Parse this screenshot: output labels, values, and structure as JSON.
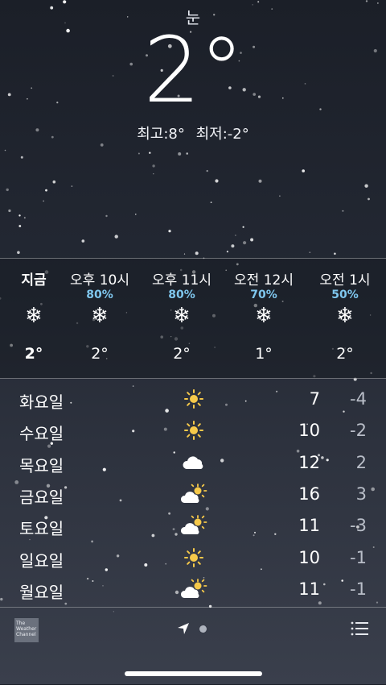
{
  "current": {
    "condition": "눈",
    "temperature": "2°",
    "high": "최고:8°",
    "low": "최저:-2°"
  },
  "hourly": [
    {
      "label": "지금",
      "pop": "",
      "icon": "snowflake-icon",
      "temp": "2°"
    },
    {
      "label": "오후 10시",
      "pop": "80%",
      "icon": "snowflake-icon",
      "temp": "2°"
    },
    {
      "label": "오후 11시",
      "pop": "80%",
      "icon": "snowflake-icon",
      "temp": "2°"
    },
    {
      "label": "오전 12시",
      "pop": "70%",
      "icon": "snowflake-icon",
      "temp": "1°"
    },
    {
      "label": "오전 1시",
      "pop": "50%",
      "icon": "snowflake-icon",
      "temp": "2°"
    }
  ],
  "daily": [
    {
      "day": "화요일",
      "icon": "sun-icon",
      "high": "7",
      "low": "-4"
    },
    {
      "day": "수요일",
      "icon": "sun-icon",
      "high": "10",
      "low": "-2"
    },
    {
      "day": "목요일",
      "icon": "cloud-icon",
      "high": "12",
      "low": "2"
    },
    {
      "day": "금요일",
      "icon": "partly-cloudy-icon",
      "high": "16",
      "low": "3"
    },
    {
      "day": "토요일",
      "icon": "partly-cloudy-icon",
      "high": "11",
      "low": "-3"
    },
    {
      "day": "일요일",
      "icon": "sun-icon",
      "high": "10",
      "low": "-1"
    },
    {
      "day": "월요일",
      "icon": "partly-cloudy-icon",
      "high": "11",
      "low": "-1"
    }
  ],
  "footer": {
    "logo_text": "The Weather Channel",
    "logo_icon": "weather-channel-logo",
    "location_icon": "location-arrow-icon",
    "page_dot_icon": "page-dot",
    "list_icon": "list-icon"
  },
  "colors": {
    "precip": "#7fc7ee",
    "sun": "#f6c94a",
    "low_temp": "#b9bec8"
  }
}
